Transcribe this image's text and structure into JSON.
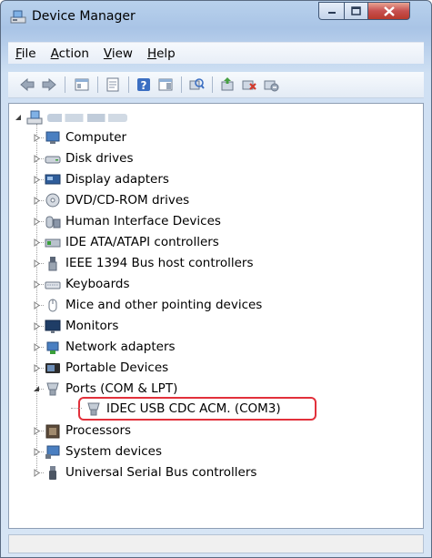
{
  "window": {
    "title": "Device Manager"
  },
  "menu": {
    "items": [
      {
        "key": "F",
        "rest": "ile"
      },
      {
        "key": "A",
        "rest": "ction"
      },
      {
        "key": "V",
        "rest": "iew"
      },
      {
        "key": "H",
        "rest": "elp"
      }
    ]
  },
  "toolbar": {
    "icons": [
      "back-arrow-icon",
      "forward-arrow-icon",
      "show-hide-console-tree-icon",
      "properties-icon",
      "help-icon",
      "action-pane-icon",
      "scan-hardware-changes-icon",
      "update-driver-icon",
      "uninstall-device-icon",
      "disable-device-icon"
    ]
  },
  "tree": {
    "root_label": "",
    "categories": [
      {
        "label": "Computer",
        "icon": "computer-icon"
      },
      {
        "label": "Disk drives",
        "icon": "disk-drive-icon"
      },
      {
        "label": "Display adapters",
        "icon": "display-adapter-icon"
      },
      {
        "label": "DVD/CD-ROM drives",
        "icon": "dvd-drive-icon"
      },
      {
        "label": "Human Interface Devices",
        "icon": "hid-icon"
      },
      {
        "label": "IDE ATA/ATAPI controllers",
        "icon": "ide-controller-icon"
      },
      {
        "label": "IEEE 1394 Bus host controllers",
        "icon": "ieee1394-icon"
      },
      {
        "label": "Keyboards",
        "icon": "keyboard-icon"
      },
      {
        "label": "Mice and other pointing devices",
        "icon": "mouse-icon"
      },
      {
        "label": "Monitors",
        "icon": "monitor-icon"
      },
      {
        "label": "Network adapters",
        "icon": "network-adapter-icon"
      },
      {
        "label": "Portable Devices",
        "icon": "portable-device-icon"
      },
      {
        "label": "Ports (COM & LPT)",
        "icon": "port-icon"
      },
      {
        "label": "Processors",
        "icon": "processor-icon"
      },
      {
        "label": "System devices",
        "icon": "system-device-icon"
      },
      {
        "label": "Universal Serial Bus controllers",
        "icon": "usb-icon"
      }
    ],
    "port_child": {
      "label": "IDEC USB CDC ACM. (COM3)",
      "icon": "port-icon"
    }
  },
  "colors": {
    "highlight_border": "#e2303b",
    "close_button": "#c75050",
    "titlebar": "#b8d1ec"
  }
}
